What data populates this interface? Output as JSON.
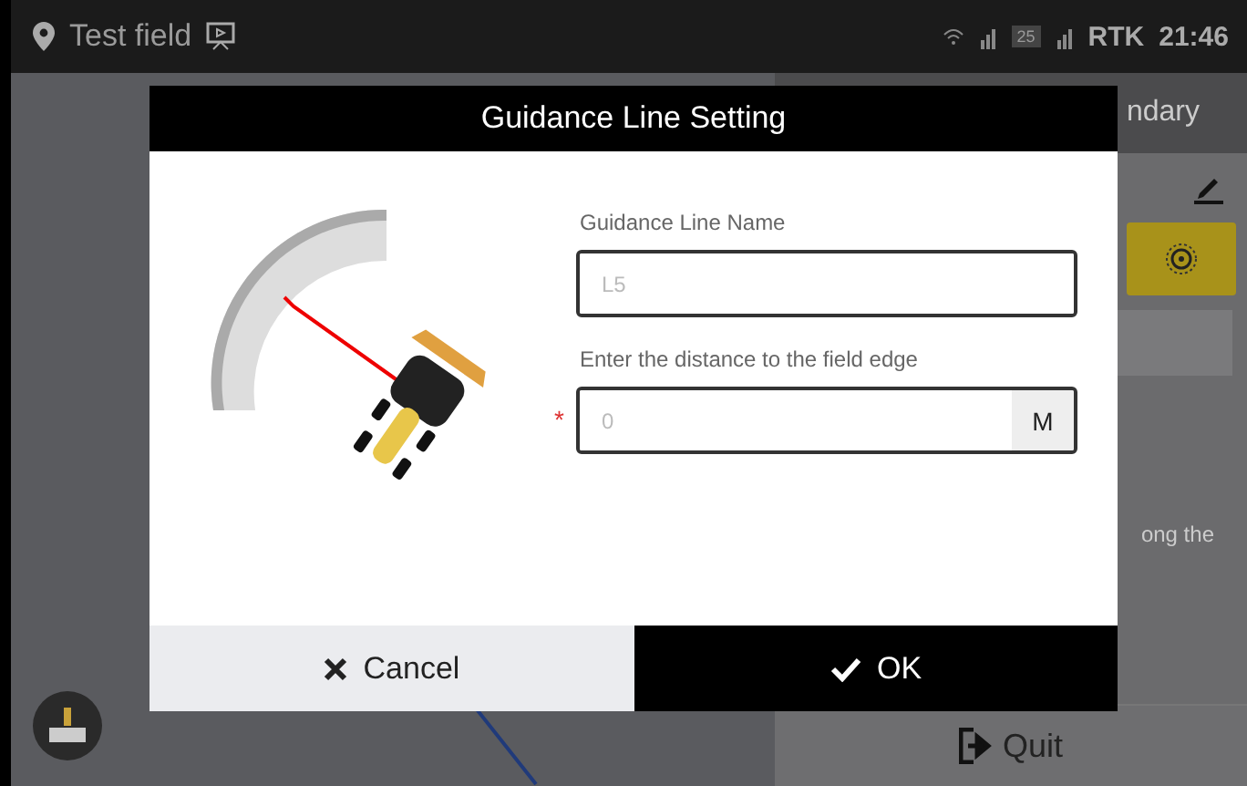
{
  "status_bar": {
    "field_name": "Test field",
    "sim_badge": "25",
    "gnss": "RTK",
    "time": "21:46"
  },
  "side_panel": {
    "title": "ndary",
    "note": "ong the",
    "quit": "Quit"
  },
  "dialog": {
    "title": "Guidance Line Setting",
    "fields": [
      {
        "label": "Guidance Line Name",
        "placeholder": "L5"
      },
      {
        "label": "Enter the distance to the field edge",
        "placeholder": "0",
        "required_mark": "*",
        "unit": "M"
      }
    ],
    "buttons": [
      {
        "kind": "cancel",
        "label": "Cancel"
      },
      {
        "kind": "ok",
        "label": "OK"
      }
    ]
  }
}
